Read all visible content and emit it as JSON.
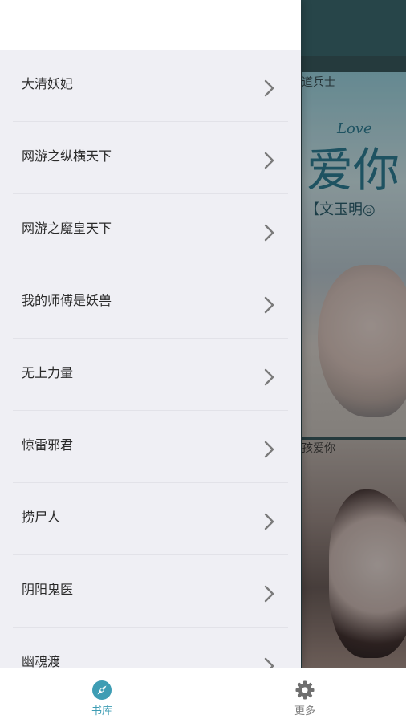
{
  "background": {
    "cards": [
      {
        "title_fragment": "道兵士"
      },
      {
        "title_fragment": "孩爱你"
      }
    ],
    "art_text": "爱你",
    "art_subtext": "Love",
    "art_author": "【文玉明◎"
  },
  "drawer": {
    "items": [
      {
        "label": "大清妖妃"
      },
      {
        "label": "网游之纵横天下"
      },
      {
        "label": "网游之魔皇天下"
      },
      {
        "label": "我的师傅是妖兽"
      },
      {
        "label": "无上力量"
      },
      {
        "label": "惊雷邪君"
      },
      {
        "label": "捞尸人"
      },
      {
        "label": "阴阳鬼医"
      },
      {
        "label": "幽魂渡"
      }
    ]
  },
  "tabbar": {
    "tabs": [
      {
        "label": "书库",
        "icon": "compass-icon",
        "active": true
      },
      {
        "label": "更多",
        "icon": "gear-icon",
        "active": false
      }
    ]
  },
  "colors": {
    "accent": "#3e9db4",
    "inactive": "#7f7f7f",
    "drawer_bg": "#efeff4"
  }
}
